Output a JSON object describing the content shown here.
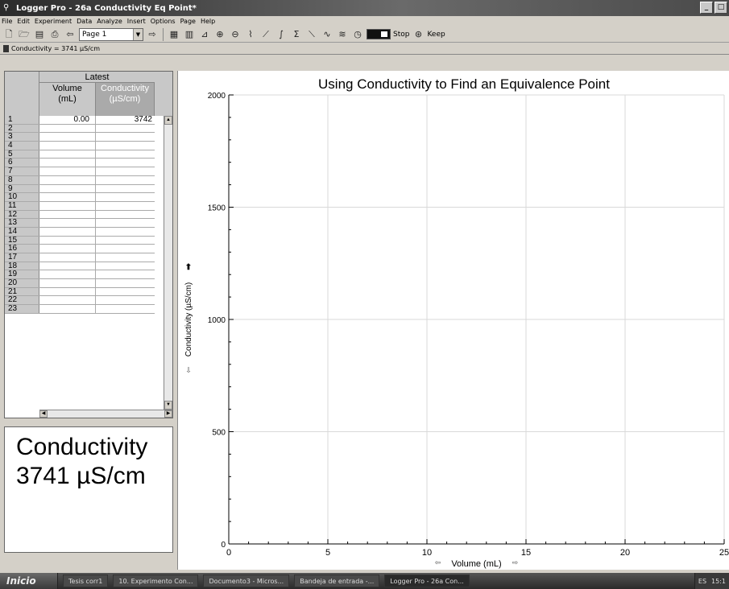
{
  "window": {
    "title": "Logger Pro - 26a Conductivity Eq Point*",
    "controls": [
      "_",
      "□",
      "×"
    ]
  },
  "menu": [
    "File",
    "Edit",
    "Experiment",
    "Data",
    "Analyze",
    "Insert",
    "Options",
    "Page",
    "Help"
  ],
  "toolbar": {
    "page_value": "Page 1",
    "stop_label": "Stop",
    "keep_label": "Keep"
  },
  "meterbar": {
    "reading": "Conductivity = 3741 µS/cm"
  },
  "table": {
    "set_name": "Latest",
    "col_volume": [
      "Volume",
      "(mL)"
    ],
    "col_conductivity": [
      "Conductivity",
      "(µS/cm)"
    ],
    "rows": [
      {
        "n": "1",
        "volume": "0.00",
        "conductivity": "3742"
      },
      {
        "n": "2",
        "volume": "",
        "conductivity": ""
      },
      {
        "n": "3",
        "volume": "",
        "conductivity": ""
      },
      {
        "n": "4",
        "volume": "",
        "conductivity": ""
      },
      {
        "n": "5",
        "volume": "",
        "conductivity": ""
      },
      {
        "n": "6",
        "volume": "",
        "conductivity": ""
      },
      {
        "n": "7",
        "volume": "",
        "conductivity": ""
      },
      {
        "n": "8",
        "volume": "",
        "conductivity": ""
      },
      {
        "n": "9",
        "volume": "",
        "conductivity": ""
      },
      {
        "n": "10",
        "volume": "",
        "conductivity": ""
      },
      {
        "n": "11",
        "volume": "",
        "conductivity": ""
      },
      {
        "n": "12",
        "volume": "",
        "conductivity": ""
      },
      {
        "n": "13",
        "volume": "",
        "conductivity": ""
      },
      {
        "n": "14",
        "volume": "",
        "conductivity": ""
      },
      {
        "n": "15",
        "volume": "",
        "conductivity": ""
      },
      {
        "n": "16",
        "volume": "",
        "conductivity": ""
      },
      {
        "n": "17",
        "volume": "",
        "conductivity": ""
      },
      {
        "n": "18",
        "volume": "",
        "conductivity": ""
      },
      {
        "n": "19",
        "volume": "",
        "conductivity": ""
      },
      {
        "n": "20",
        "volume": "",
        "conductivity": ""
      },
      {
        "n": "21",
        "volume": "",
        "conductivity": ""
      },
      {
        "n": "22",
        "volume": "",
        "conductivity": ""
      },
      {
        "n": "23",
        "volume": "",
        "conductivity": ""
      }
    ]
  },
  "meter": {
    "label": "Conductivity",
    "value": "3741 µS/cm"
  },
  "chart_data": {
    "type": "scatter",
    "title": "Using Conductivity to Find an Equivalence Point",
    "xlabel": "Volume (mL)",
    "ylabel": "Conductivity (µS/cm)",
    "xlim": [
      0,
      25
    ],
    "ylim": [
      0,
      2000
    ],
    "x_ticks": [
      0,
      5,
      10,
      15,
      20,
      25
    ],
    "y_ticks": [
      0,
      500,
      1000,
      1500,
      2000
    ],
    "grid": true,
    "series": [
      {
        "x": [
          0
        ],
        "y": [
          3742
        ]
      }
    ]
  },
  "taskbar": {
    "start_label": "Inicio",
    "tasks": [
      "Tesis corr1",
      "10. Experimento Con...",
      "Documento3 - Micros...",
      "Bandeja de entrada -...",
      "Logger Pro - 26a Con..."
    ],
    "tray": [
      "ES",
      "15:1"
    ]
  },
  "colors": {
    "grid": "#d9d9d9",
    "axis": "#000000",
    "panel": "#d4d0c8"
  }
}
